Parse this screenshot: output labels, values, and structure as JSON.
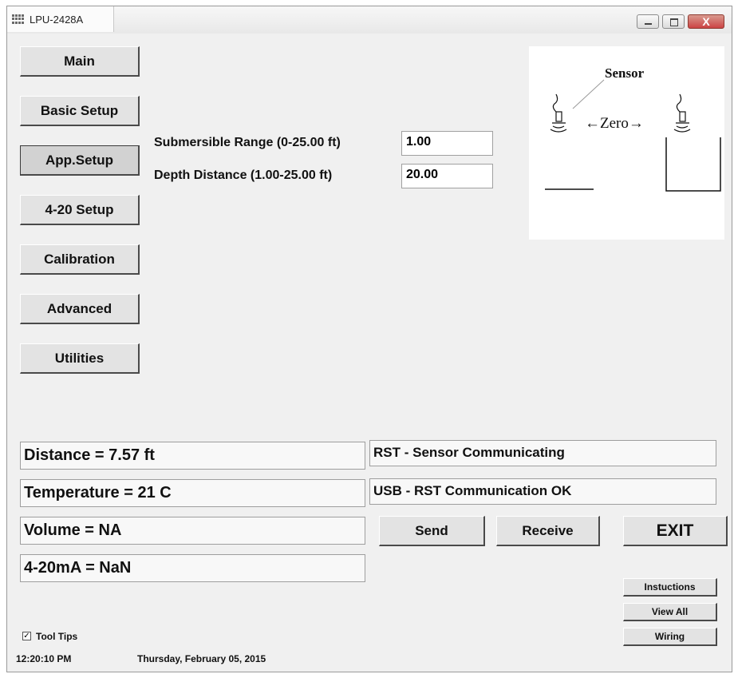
{
  "window": {
    "title": "LPU-2428A",
    "close_label": "X"
  },
  "nav": {
    "main": "Main",
    "basic_setup": "Basic Setup",
    "app_setup": "App.Setup",
    "setup_420": "4-20 Setup",
    "calibration": "Calibration",
    "advanced": "Advanced",
    "utilities": "Utilities"
  },
  "app_setup": {
    "submersible_range_label": "Submersible Range (0-25.00 ft)",
    "submersible_range_value": "1.00",
    "depth_distance_label": "Depth Distance (1.00-25.00 ft)",
    "depth_distance_value": "20.00"
  },
  "diagram": {
    "sensor_label": "Sensor",
    "zero_label": "←Zero→"
  },
  "readouts": {
    "distance": "Distance = 7.57 ft",
    "temperature": "Temperature = 21 C",
    "volume": "Volume = NA",
    "current": "4-20mA = NaN"
  },
  "status": {
    "sensor": "RST - Sensor Communicating",
    "usb": "USB - RST Communication OK"
  },
  "actions": {
    "send": "Send",
    "receive": "Receive",
    "exit": "EXIT"
  },
  "links": {
    "instructions": "Instuctions",
    "view_all": "View All",
    "wiring": "Wiring"
  },
  "footer": {
    "tool_tips_label": "Tool Tips",
    "tool_tips_checked": true,
    "time": "12:20:10 PM",
    "date": "Thursday, February 05, 2015"
  }
}
